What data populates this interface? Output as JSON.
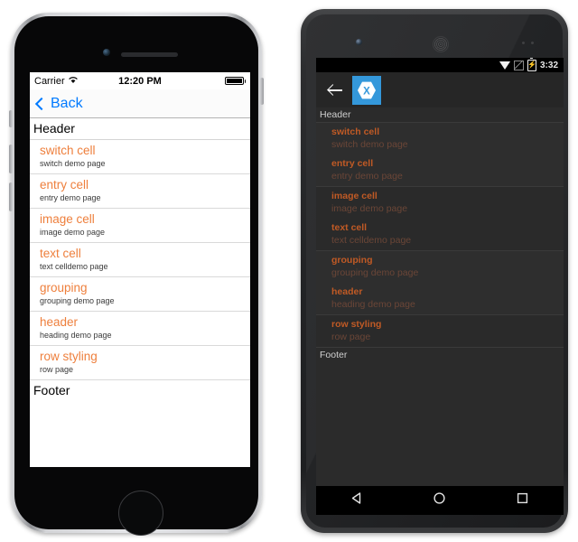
{
  "ios": {
    "status": {
      "carrier": "Carrier",
      "wifi_icon": "wifi-icon",
      "time": "12:20 PM",
      "battery_icon": "battery-full-icon"
    },
    "navbar": {
      "back_label": "Back",
      "back_chevron_icon": "chevron-left-icon",
      "back_color": "#007aff"
    },
    "list": {
      "header_label": "Header",
      "footer_label": "Footer",
      "title_color": "#ee7f3c",
      "subtitle_color": "#3a3a3a",
      "rows": [
        {
          "title": "switch cell",
          "subtitle": "switch demo page"
        },
        {
          "title": "entry cell",
          "subtitle": "entry demo page"
        },
        {
          "title": "image cell",
          "subtitle": "image demo page"
        },
        {
          "title": "text cell",
          "subtitle": "text celldemo page"
        },
        {
          "title": "grouping",
          "subtitle": "grouping demo page"
        },
        {
          "title": "header",
          "subtitle": "heading demo page"
        },
        {
          "title": "row styling",
          "subtitle": "row page"
        }
      ]
    }
  },
  "android": {
    "status": {
      "wifi_icon": "wifi-icon",
      "signal_icon": "signal-off-icon",
      "battery_icon": "battery-charging-icon",
      "battery_glyph": "⚡",
      "time": "3:32"
    },
    "actionbar": {
      "back_icon": "back-arrow-icon",
      "app_logo_icon": "xamarin-logo-icon",
      "logo_bg": "#3498db"
    },
    "list": {
      "header_label": "Header",
      "footer_label": "Footer",
      "title_color": "#c05a25",
      "subtitle_color": "#6b4637",
      "rows": [
        {
          "title": "switch cell",
          "subtitle": "switch demo page"
        },
        {
          "title": "entry cell",
          "subtitle": "entry demo page"
        },
        {
          "title": "image cell",
          "subtitle": "image demo page"
        },
        {
          "title": "text cell",
          "subtitle": "text celldemo page"
        },
        {
          "title": "grouping",
          "subtitle": "grouping demo page"
        },
        {
          "title": "header",
          "subtitle": "heading demo page"
        },
        {
          "title": "row styling",
          "subtitle": "row page"
        }
      ]
    },
    "navbar": {
      "back_icon": "nav-back-icon",
      "home_icon": "nav-home-icon",
      "recents_icon": "nav-recents-icon"
    }
  }
}
